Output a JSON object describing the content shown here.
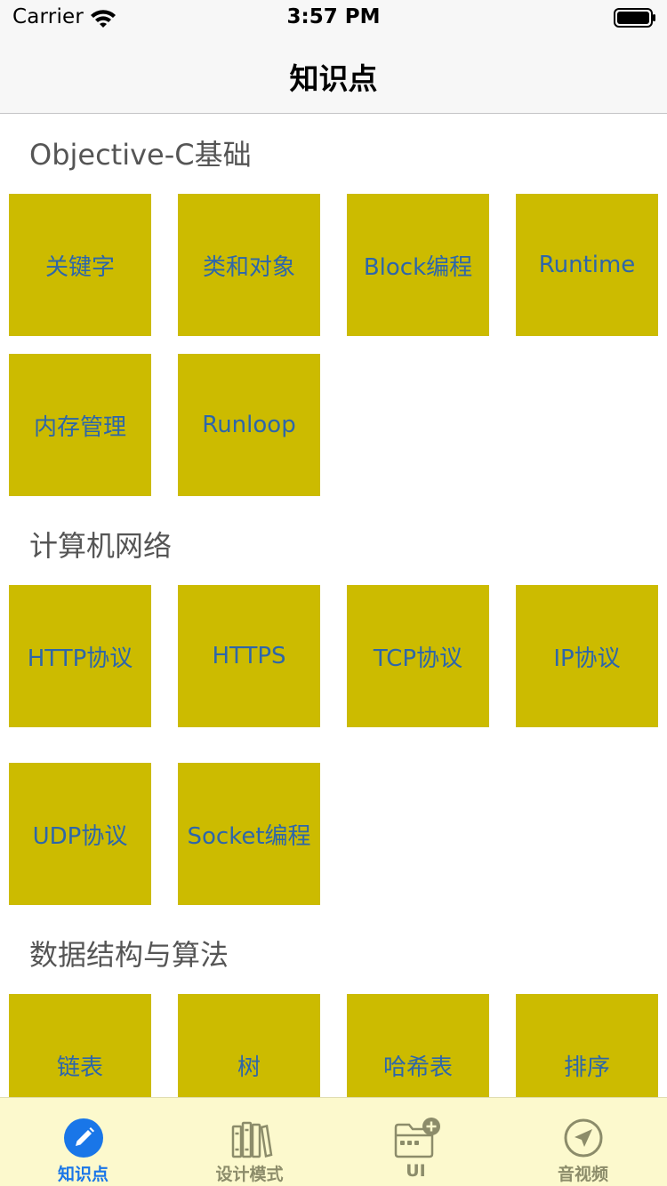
{
  "status_bar": {
    "carrier": "Carrier",
    "time": "3:57 PM"
  },
  "nav": {
    "title": "知识点"
  },
  "sections": [
    {
      "title": "Objective-C基础",
      "items": [
        "关键字",
        "类和对象",
        "Block编程",
        "Runtime",
        "内存管理",
        "Runloop"
      ]
    },
    {
      "title": "计算机网络",
      "items": [
        "HTTP协议",
        "HTTPS",
        "TCP协议",
        "IP协议",
        "UDP协议",
        "Socket编程"
      ]
    },
    {
      "title": "数据结构与算法",
      "items": [
        "链表",
        "树",
        "哈希表",
        "排序"
      ]
    }
  ],
  "tab_bar": {
    "tabs": [
      {
        "label": "知识点",
        "icon": "pencil-circle-icon",
        "active": true
      },
      {
        "label": "设计模式",
        "icon": "books-icon",
        "active": false
      },
      {
        "label": "UI",
        "icon": "folder-add-icon",
        "active": false
      },
      {
        "label": "音视频",
        "icon": "send-circle-icon",
        "active": false
      }
    ]
  },
  "colors": {
    "tile_background": "#ccbb00",
    "tile_text": "#2d66aa",
    "section_text": "#555555",
    "tab_bar_background": "#fcf9cd",
    "tab_active": "#1976e8",
    "tab_inactive": "#8c8c6a"
  }
}
